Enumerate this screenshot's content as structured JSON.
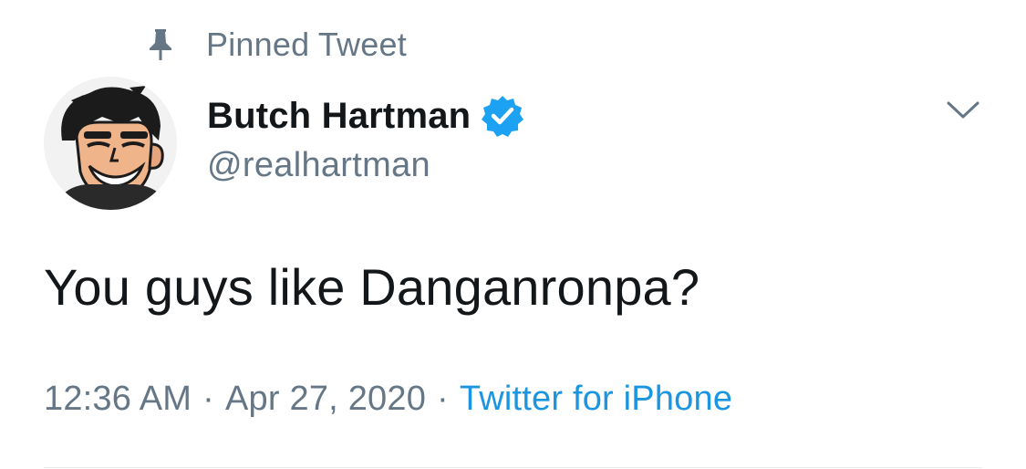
{
  "pinned": {
    "icon": "pin-icon",
    "label": "Pinned Tweet"
  },
  "author": {
    "avatar_icon": "cartoon-avatar",
    "display_name": "Butch Hartman",
    "verified_icon": "verified-badge-icon",
    "handle": "@realhartman"
  },
  "menu": {
    "icon": "chevron-down-icon"
  },
  "tweet": {
    "text": "You guys like Danganronpa?"
  },
  "meta": {
    "time": "12:36 AM",
    "separator": "·",
    "date": "Apr 27, 2020",
    "source": "Twitter for iPhone"
  },
  "colors": {
    "secondary_text": "#657786",
    "primary_text": "#14171a",
    "link_blue": "#1b95e0",
    "verified_blue": "#1da1f2",
    "divider": "#e6ecf0"
  }
}
